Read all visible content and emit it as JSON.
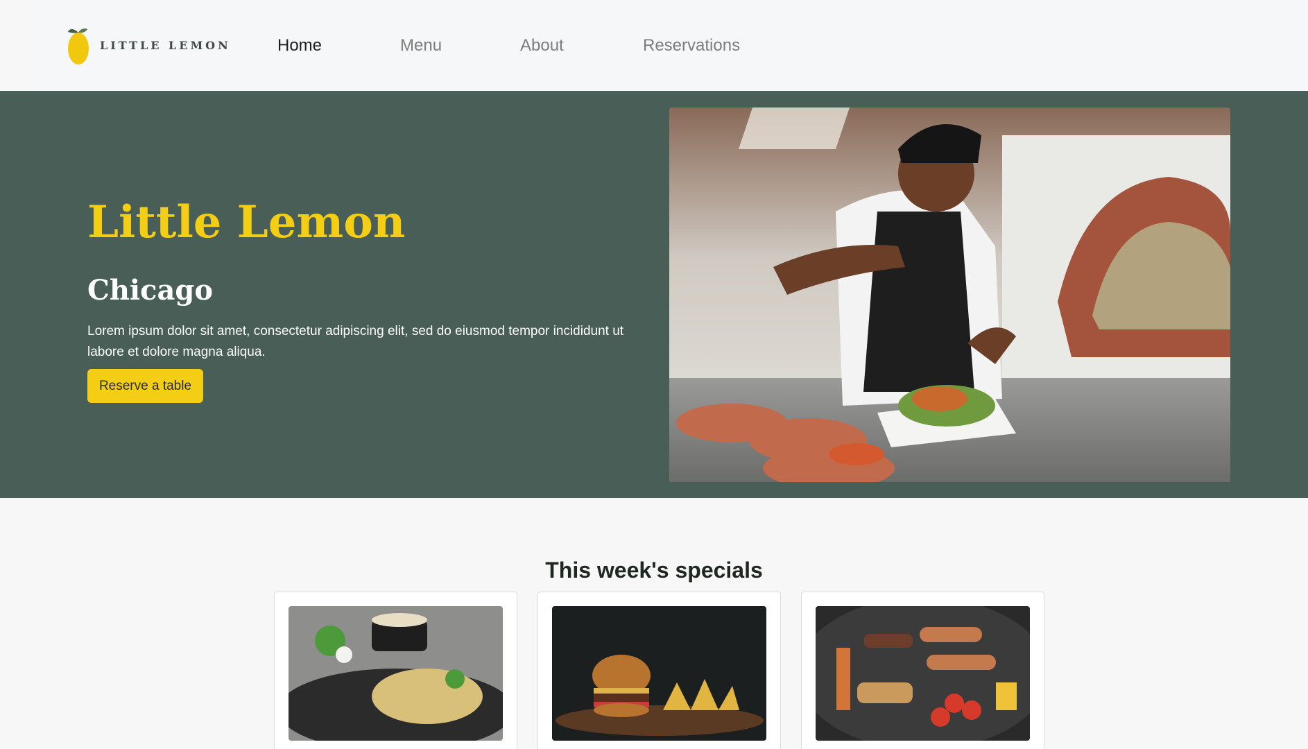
{
  "brand": {
    "name": "LITTLE LEMON"
  },
  "nav": {
    "items": [
      {
        "label": "Home",
        "active": true
      },
      {
        "label": "Menu",
        "active": false
      },
      {
        "label": "About",
        "active": false
      },
      {
        "label": "Reservations",
        "active": false
      }
    ]
  },
  "hero": {
    "title": "Little Lemon",
    "city": "Chicago",
    "description": "Lorem ipsum dolor sit amet, consectetur adipiscing elit, sed do eiusmod tempor incididunt ut labore et dolore magna aliqua.",
    "cta_label": "Reserve a table"
  },
  "specials": {
    "title": "This week's specials"
  },
  "colors": {
    "primary_green": "#495e57",
    "primary_yellow": "#f4ce14",
    "nav_bg": "#f6f7f8",
    "page_bg": "#f7f7f7"
  },
  "icons": {
    "logo": "lemon-icon"
  }
}
